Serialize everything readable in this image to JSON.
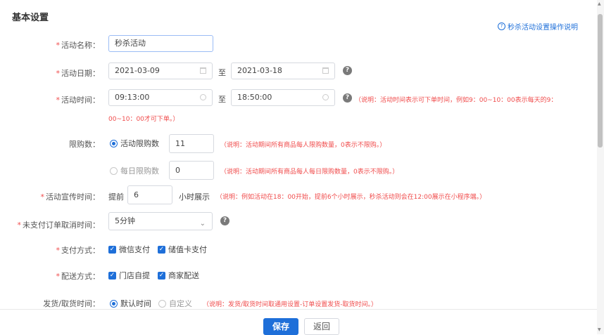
{
  "page": {
    "title": "基本设置",
    "help_link": "秒杀活动设置操作说明"
  },
  "form": {
    "name": {
      "label": "活动名称：",
      "value": "秒杀活动"
    },
    "date": {
      "label": "活动日期：",
      "start": "2021-03-09",
      "to": "至",
      "end": "2021-03-18"
    },
    "time": {
      "label": "活动时间：",
      "start": "09:13:00",
      "to": "至",
      "end": "18:50:00",
      "note_line1": "（说明：活动时间表示可下单时间，例如9：00~10：00表示每天的9：",
      "note_line2": "00~10：00才可下单。）"
    },
    "limit": {
      "label": "限购数：",
      "activity_label": "活动限购数",
      "activity_value": "11",
      "activity_note": "（说明：活动期间所有商品每人限购数量，0表示不限购。）",
      "daily_label": "每日限购数",
      "daily_value": "0",
      "daily_note": "（说明：活动期间所有商品每人每日限购数量，0表示不限购。）"
    },
    "promo": {
      "label": "活动宣传时间：",
      "prefix": "提前",
      "value": "6",
      "suffix": "小时展示",
      "note": "（说明：例如活动在18：00开始，提前6个小时展示，秒杀活动则会在12:00展示在小程序端。）"
    },
    "cancel": {
      "label": "未支付订单取消时间：",
      "value": "5分钟"
    },
    "payment": {
      "label": "支付方式：",
      "opt1": "微信支付",
      "opt2": "储值卡支付"
    },
    "delivery": {
      "label": "配送方式：",
      "opt1": "门店自提",
      "opt2": "商家配送"
    },
    "ship_time": {
      "label": "发货/取货时间：",
      "opt1": "默认时间",
      "opt2": "自定义",
      "note": "（说明：发货/取货时间取通用设置-订单设置发货-取货时间。）"
    }
  },
  "footer": {
    "save": "保存",
    "back": "返回"
  },
  "colors": {
    "accent": "#1e6fd9",
    "required": "#f04c4c",
    "note": "#f04c4c"
  }
}
